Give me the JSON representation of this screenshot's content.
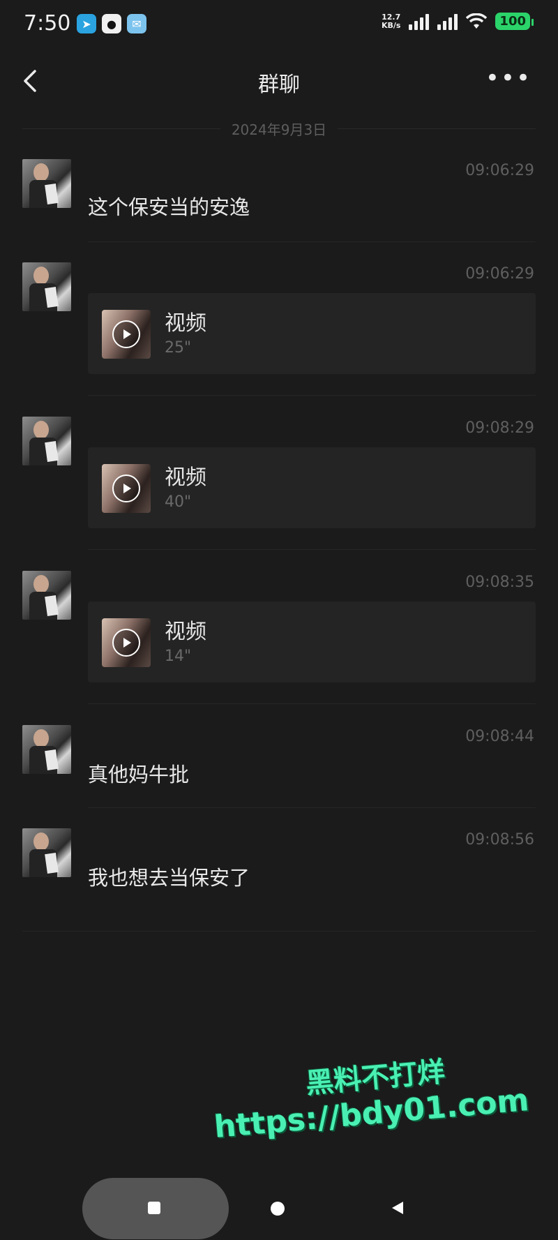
{
  "status": {
    "time": "7:50",
    "speed_value": "12.7",
    "speed_unit": "KB/s",
    "battery": "100",
    "app_icons": [
      "telegram-icon",
      "qq-icon",
      "mail-icon"
    ]
  },
  "header": {
    "title": "群聊",
    "more": "•••"
  },
  "date_separator": "2024年9月3日",
  "messages": [
    {
      "type": "text",
      "time": "09:06:29",
      "text": "这个保安当的安逸"
    },
    {
      "type": "video",
      "time": "09:06:29",
      "label": "视频",
      "duration": "25\""
    },
    {
      "type": "video",
      "time": "09:08:29",
      "label": "视频",
      "duration": "40\""
    },
    {
      "type": "video",
      "time": "09:08:35",
      "label": "视频",
      "duration": "14\""
    },
    {
      "type": "text",
      "time": "09:08:44",
      "text": "真他妈牛批"
    },
    {
      "type": "text",
      "time": "09:08:56",
      "text": "我也想去当保安了"
    }
  ],
  "watermark": {
    "line1": "黑料不打烊",
    "line2": "https://bdy01.com"
  },
  "colors": {
    "background": "#1b1b1b",
    "card": "#242424",
    "watermark": "#4af0b3",
    "battery": "#2bd46a"
  }
}
